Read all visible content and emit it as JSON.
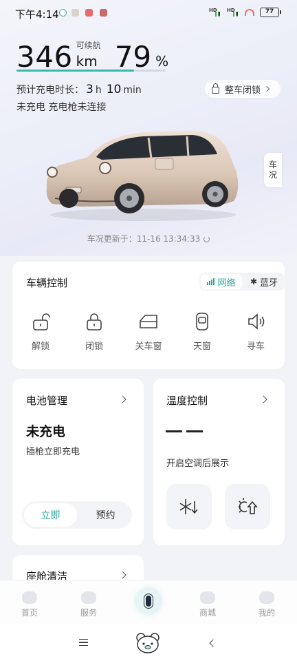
{
  "status_bar": {
    "time": "下午4:14",
    "signal_1": "HD",
    "signal_2": "HD",
    "battery": "77"
  },
  "vehicle": {
    "range_value": "346",
    "range_label": "可续航",
    "range_unit": "km",
    "battery_percent": "79",
    "battery_percent_unit": "%",
    "battery_level_fraction": 0.79,
    "charge_time_label": "预计充电时长：",
    "charge_hours": "3",
    "charge_hours_unit": "h",
    "charge_minutes": "10",
    "charge_minutes_unit": "min",
    "charge_status": "未充电  充电枪未连接",
    "lock_all_label": "整车闭锁",
    "side_tab": [
      "车",
      "况"
    ],
    "update_text": "车况更新于：11-16 13:34:33"
  },
  "vehicle_control": {
    "title": "车辆控制",
    "network_label": "网络",
    "bluetooth_label": "蓝牙",
    "buttons": [
      {
        "label": "解锁",
        "icon": "unlock-icon"
      },
      {
        "label": "闭锁",
        "icon": "lock-icon"
      },
      {
        "label": "关车窗",
        "icon": "window-icon"
      },
      {
        "label": "天窗",
        "icon": "sunroof-icon"
      },
      {
        "label": "寻车",
        "icon": "horn-icon"
      }
    ]
  },
  "battery_management": {
    "title": "电池管理",
    "status": "未充电",
    "subtitle": "插枪立即充电",
    "options": [
      "立即",
      "预约"
    ]
  },
  "temperature_control": {
    "title": "温度控制",
    "hint": "开启空调后展示",
    "buttons": [
      "cooling-icon",
      "heating-icon"
    ]
  },
  "cabin_cleaning": {
    "title": "座舱清洁"
  },
  "tab_bar": {
    "tabs": [
      {
        "label": "首页"
      },
      {
        "label": "服务"
      },
      {
        "label": "商城"
      },
      {
        "label": "我的"
      }
    ]
  },
  "colors": {
    "accent": "#2aa79b",
    "progress": "#3bb8a9",
    "background": "#f2f3f7"
  }
}
